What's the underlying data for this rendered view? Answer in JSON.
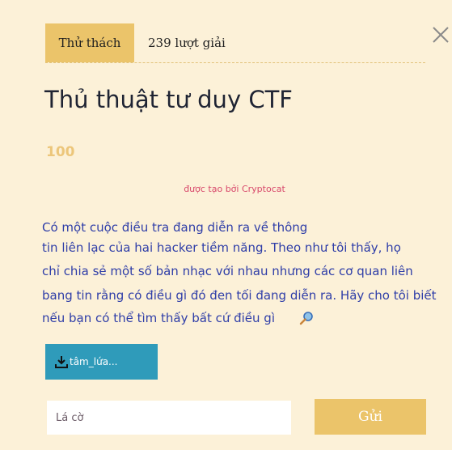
{
  "tabs": {
    "active_label": "Thử thách",
    "solves_label": "239 lượt giải"
  },
  "challenge": {
    "title": "Thủ thuật tư duy CTF",
    "points": "100",
    "author": "được tạo bởi Cryptocat",
    "description_lines": [
      "Có một cuộc điều tra đang diễn ra về thông",
      "tin liên lạc của hai hacker tiềm năng. Theo như tôi thấy, họ",
      "chỉ chia sẻ một số bản nhạc với nhau nhưng các cơ quan liên",
      "bang tin rằng có điều gì đó đen tối đang diễn ra. Hãy cho tôi biết",
      "nếu bạn có thể tìm thấy bất cứ điều gì"
    ]
  },
  "download": {
    "label": "tâm_lứa...",
    "icon": "download-icon"
  },
  "form": {
    "flag_placeholder": "Lá cờ",
    "flag_value": "",
    "submit_label": "Gửi"
  },
  "icons": {
    "close": "close-icon",
    "key": "magnifier-icon"
  },
  "colors": {
    "background": "#fcf1d8",
    "accent": "#ebc46a",
    "download_button": "#2f9bba",
    "author_text": "#d8486b",
    "description_text": "#2f3ea8"
  }
}
